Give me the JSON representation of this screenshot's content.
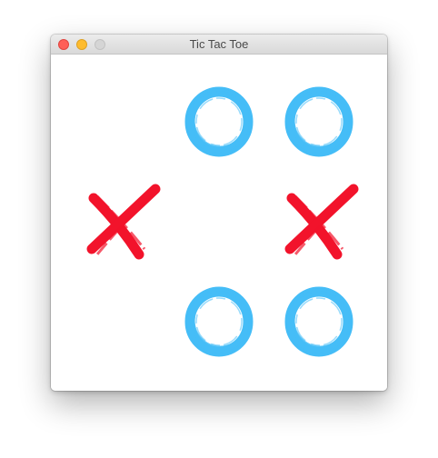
{
  "window": {
    "title": "Tic Tac Toe",
    "controls": [
      "close",
      "minimize",
      "zoom"
    ]
  },
  "colors": {
    "close": "#ff5f57",
    "close_border": "#e0443e",
    "minimize": "#febc2e",
    "minimize_border": "#dea123",
    "zoom_inactive": "#d5d5d5",
    "zoom_border": "#c2c2c2",
    "x_mark": "#f2132b",
    "o_mark": "#45bdf7"
  },
  "board": {
    "rows": 3,
    "cols": 3,
    "cells": [
      [
        "",
        "O",
        "O"
      ],
      [
        "X",
        "",
        "X"
      ],
      [
        "",
        "O",
        "O"
      ]
    ]
  }
}
